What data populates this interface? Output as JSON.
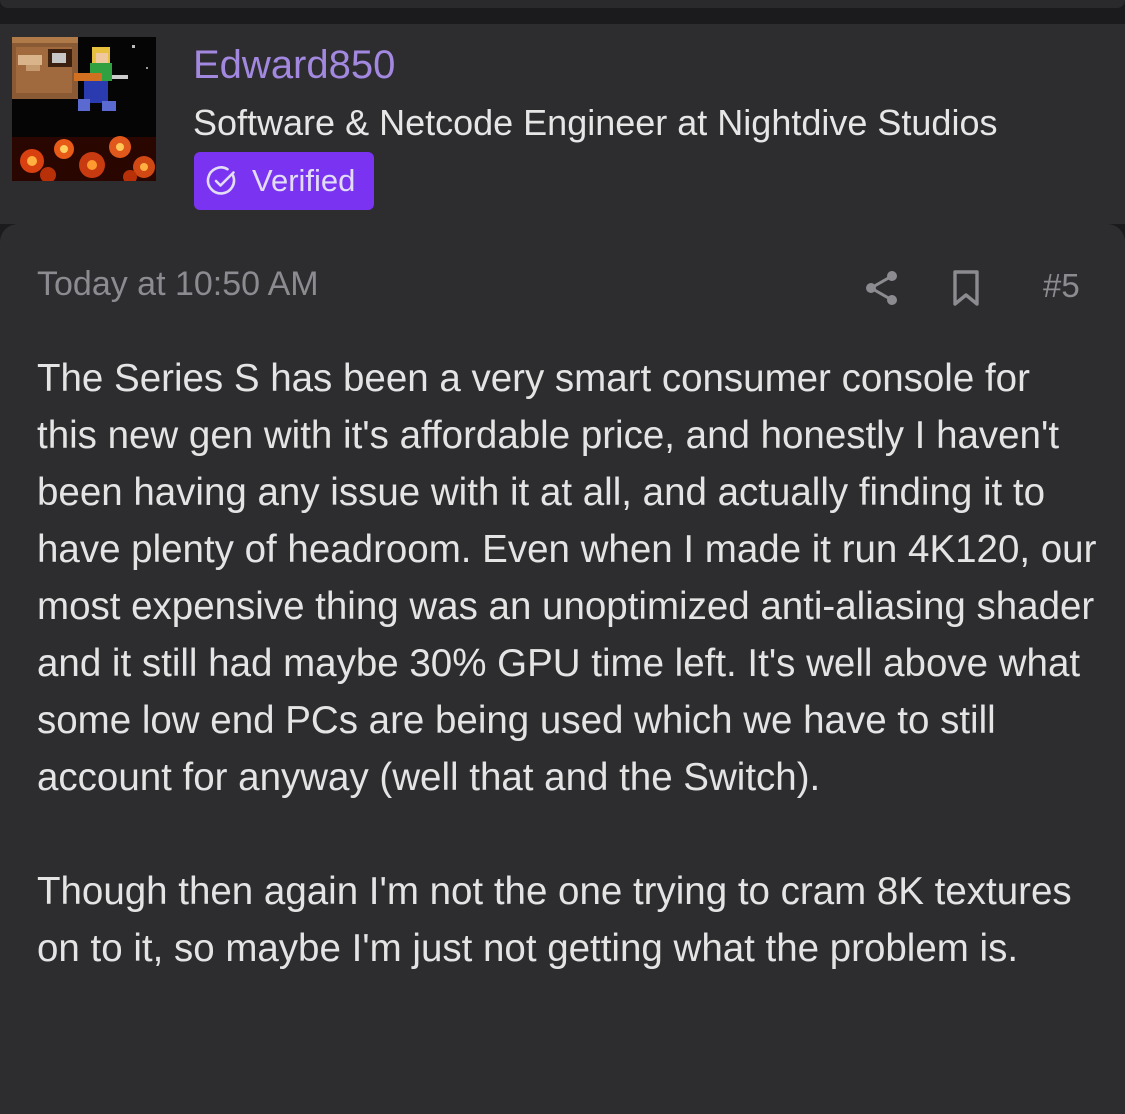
{
  "user": {
    "name": "Edward850",
    "title": "Software & Netcode Engineer at Nightdive Studios",
    "badge": "Verified",
    "avatar_icon": "pixel-art-avatar"
  },
  "post": {
    "timestamp": "Today at 10:50 AM",
    "number": "#5",
    "share_icon": "share-icon",
    "bookmark_icon": "bookmark-icon",
    "paragraphs": [
      "The Series S has been a very smart consumer console for this new gen with it's affordable price, and honestly I haven't been having any issue with it at all, and actually finding it to have plenty of headroom. Even when I made it run 4K120, our most expensive thing was an unoptimized anti-aliasing shader and it still had maybe 30% GPU time left. It's well above what some low end PCs are being used which we have to still account for anyway (well that and the Switch).",
      "Though then again I'm not the one trying to cram 8K textures on to it, so maybe I'm just not getting what the problem is."
    ]
  },
  "colors": {
    "background": "#1b1b1d",
    "card": "#2d2d30",
    "username": "#a388e0",
    "badge": "#7a33f0",
    "muted": "#8b8b90",
    "text": "#e4e4e4"
  }
}
